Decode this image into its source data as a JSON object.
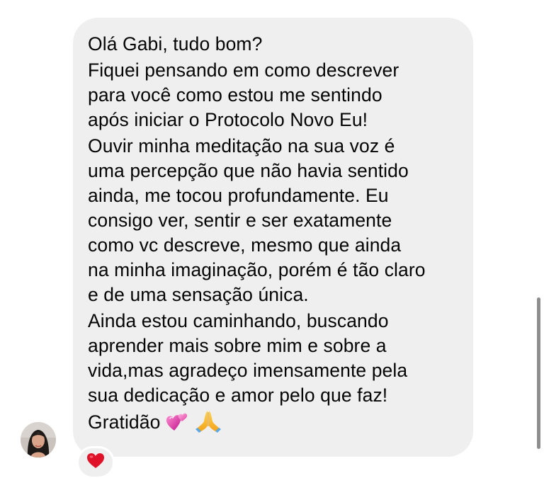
{
  "message": {
    "paragraphs": [
      "Olá Gabi, tudo bom?",
      "Fiquei pensando em como descrever\npara você como estou me sentindo\napós iniciar o Protocolo Novo Eu!",
      "Ouvir minha meditação na sua voz é\numa percepção que não havia sentido\nainda, me tocou profundamente. Eu\nconsigo ver, sentir e ser exatamente\ncomo vc descreve, mesmo que ainda\nna minha imaginação, porém é tão claro\ne de uma sensação única.",
      "Ainda estou caminhando, buscando\naprender mais sobre mim e sobre a\nvida,mas agradeço imensamente pela\nsua dedicação e amor pelo que faz!"
    ],
    "closing": "Gratidão",
    "closing_emojis": [
      "revolving-hearts-icon",
      "folded-hands-icon"
    ]
  },
  "reaction": {
    "icon": "red-heart-icon",
    "color": "#e0122a"
  },
  "colors": {
    "bubble_bg": "#efefef",
    "text": "#050505",
    "scrollbar": "#8e8e8e"
  }
}
